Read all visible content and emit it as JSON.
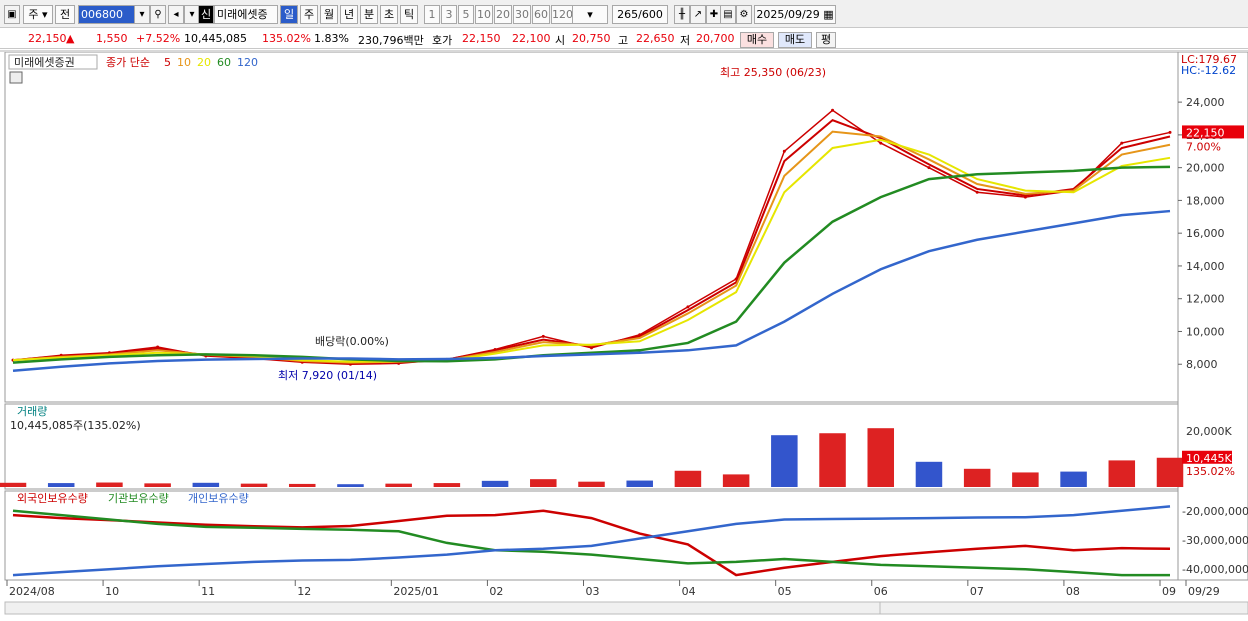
{
  "toolbar": {
    "type_label": "주",
    "prev_label": "전",
    "code_value": "006800",
    "name_chip_badge": "신",
    "stock_name": "미래에셋증",
    "periods": [
      "일",
      "주",
      "월",
      "년",
      "분",
      "초",
      "틱"
    ],
    "minutes": [
      "1",
      "3",
      "5",
      "10",
      "20",
      "30",
      "60",
      "120"
    ],
    "count": "265",
    "count_total": "/600",
    "date": "2025/09/29"
  },
  "price_bar": {
    "price": "22,150",
    "change": "1,550",
    "change_pct": "+7.52%",
    "volume": "10,445,085",
    "vol_ratio": "135.02%",
    "turnover": "1.83%",
    "amount": "230,796백만",
    "hoga_label": "호가",
    "ask": "22,150",
    "bid": "22,100",
    "open_label": "시",
    "open": "20,750",
    "high_label": "고",
    "high": "22,650",
    "low_label": "저",
    "low": "20,700",
    "buy_label": "매수",
    "sell_label": "매도",
    "eval_label": "평"
  },
  "chart_data": [
    {
      "type": "line",
      "title": "미래에셋증권",
      "legend": [
        "종가 단순",
        "5",
        "10",
        "20",
        "60",
        "120"
      ],
      "legend_colors": [
        "#cc0000",
        "#cc0000",
        "#e69519",
        "#e6e600",
        "#228b22",
        "#3366cc"
      ],
      "x_ticks": [
        "2024/08",
        "10",
        "11",
        "12",
        "2025/01",
        "02",
        "03",
        "04",
        "05",
        "06",
        "07",
        "08",
        "09",
        "09/29"
      ],
      "y_ticks": [
        "24,000",
        "22,000",
        "20,000",
        "18,000",
        "16,000",
        "14,000",
        "12,000",
        "10,000",
        "8,000"
      ],
      "ylim": [
        6000,
        25350
      ],
      "series": [
        {
          "name": "종가",
          "values": [
            8250,
            8550,
            8700,
            9050,
            8500,
            8350,
            8120,
            8000,
            8050,
            8300,
            8900,
            9700,
            9000,
            9800,
            11500,
            13200,
            21000,
            23500,
            21500,
            20000,
            18500,
            18200,
            18600,
            21500,
            22150
          ]
        },
        {
          "name": "5",
          "values": [
            8250,
            8500,
            8650,
            8950,
            8550,
            8400,
            8150,
            8050,
            8100,
            8280,
            8850,
            9500,
            9100,
            9700,
            11300,
            13000,
            20400,
            22900,
            21800,
            20200,
            18700,
            18300,
            18700,
            21200,
            21900
          ]
        },
        {
          "name": "10",
          "values": [
            8250,
            8450,
            8600,
            8850,
            8580,
            8450,
            8200,
            8100,
            8150,
            8250,
            8750,
            9350,
            9150,
            9600,
            11100,
            12800,
            19500,
            22200,
            21900,
            20500,
            19000,
            18400,
            18600,
            20800,
            21400
          ]
        },
        {
          "name": "20",
          "values": [
            8250,
            8400,
            8550,
            8700,
            8600,
            8500,
            8250,
            8150,
            8180,
            8220,
            8650,
            9150,
            9200,
            9400,
            10700,
            12400,
            18500,
            21200,
            21700,
            20800,
            19300,
            18600,
            18500,
            20100,
            20600
          ]
        },
        {
          "name": "60",
          "values": [
            8100,
            8300,
            8450,
            8550,
            8600,
            8550,
            8450,
            8300,
            8200,
            8180,
            8300,
            8550,
            8700,
            8850,
            9300,
            10600,
            14200,
            16700,
            18200,
            19300,
            19600,
            19700,
            19800,
            20000,
            20050
          ]
        },
        {
          "name": "120",
          "values": [
            7600,
            7850,
            8050,
            8200,
            8280,
            8320,
            8350,
            8350,
            8300,
            8320,
            8380,
            8500,
            8600,
            8700,
            8850,
            9150,
            10600,
            12300,
            13800,
            14900,
            15600,
            16100,
            16600,
            17100,
            17350
          ]
        }
      ],
      "annotations": {
        "high": "최고 25,350 (06/23)",
        "low": "최저 7,920 (01/14)",
        "dividend": "배당락(0.00%)"
      },
      "lc": "LC:179.67",
      "hc": "HC:-12.62",
      "current_price_tag": "22,150",
      "current_pct_tag": "7.00%"
    },
    {
      "type": "bar",
      "title": "거래량",
      "subtitle": "10,445,085주(135.02%)",
      "y_ticks": [
        "20,000K"
      ],
      "ylim": [
        0,
        25000
      ],
      "current_tag": "10,445K",
      "current_pct": "135.02%",
      "values": [
        1500,
        1400,
        1600,
        1300,
        1500,
        1200,
        1100,
        1000,
        1200,
        1400,
        2200,
        2800,
        1900,
        2300,
        5800,
        4500,
        18500,
        19200,
        21000,
        9000,
        6500,
        5200,
        5500,
        9500,
        10445
      ]
    },
    {
      "type": "line",
      "legend": [
        "외국인보유수량",
        "기관보유수량",
        "개인보유수량"
      ],
      "legend_colors": [
        "#cc0000",
        "#228b22",
        "#3366cc"
      ],
      "y_ticks": [
        "-20,000,000",
        "-30,000,000",
        "-40,000,000"
      ],
      "ylim": [
        -43000000,
        -17000000
      ],
      "series": [
        {
          "name": "외국인보유수량",
          "values": [
            -21500000,
            -22500000,
            -23200000,
            -24000000,
            -24800000,
            -25300000,
            -25700000,
            -25200000,
            -23500000,
            -21700000,
            -21500000,
            -20000000,
            -22500000,
            -27800000,
            -31500000,
            -42000000,
            -39500000,
            -37500000,
            -35500000,
            -34200000,
            -33000000,
            -32000000,
            -33500000,
            -32800000,
            -33000000
          ]
        },
        {
          "name": "기관보유수량",
          "values": [
            -20000000,
            -21500000,
            -23000000,
            -24500000,
            -25500000,
            -25800000,
            -26200000,
            -26500000,
            -27000000,
            -31000000,
            -33500000,
            -34000000,
            -35000000,
            -36500000,
            -38000000,
            -37500000,
            -36500000,
            -37500000,
            -38500000,
            -39000000,
            -39500000,
            -40000000,
            -41000000,
            -42000000,
            -42000000
          ]
        },
        {
          "name": "개인보유수량",
          "values": [
            -42000000,
            -41000000,
            -40000000,
            -39000000,
            -38200000,
            -37500000,
            -37000000,
            -36800000,
            -36000000,
            -35000000,
            -33500000,
            -33000000,
            -32000000,
            -29500000,
            -27000000,
            -24500000,
            -23000000,
            -22800000,
            -22700000,
            -22500000,
            -22300000,
            -22200000,
            -21500000,
            -20000000,
            -18500000
          ]
        }
      ]
    }
  ]
}
